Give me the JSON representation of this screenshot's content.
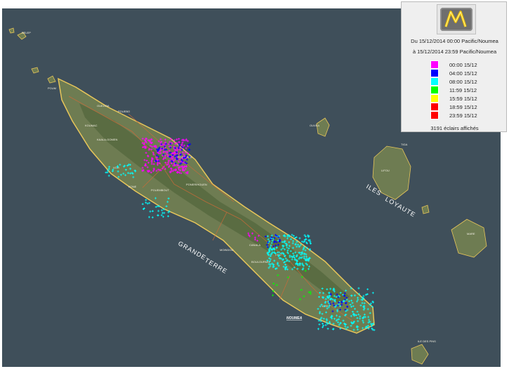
{
  "map": {
    "region_labels": {
      "grande": "GRANDE",
      "terre": "TERRE",
      "iles": "ILES",
      "loyaute": "LOYAUTE"
    },
    "capital": "NOUMEA",
    "places": {
      "belep": "BELEP",
      "poum": "POUM",
      "ouegoa": "OUEGOA",
      "pouebo": "POUEBO",
      "koumac": "KOUMAC",
      "kaala_gomen": "KAALA-GOMEN",
      "voh": "VOH",
      "kone": "KONE",
      "pouembout": "POUEMBOUT",
      "poindimie": "POINDIMIE",
      "ponerihouen": "PONERIHOUEN",
      "canala": "CANALA",
      "moindou": "MOINDOU",
      "bouloupari": "BOULOUPARI",
      "thio": "THIO",
      "yate": "YATE",
      "ouvea": "OUVEA",
      "lifou": "LIFOU",
      "mare": "MARE",
      "tiga": "TIGA",
      "ile_des_pins": "ILE DES PINS"
    },
    "colors": {
      "sea": "#3f4f5a",
      "land": "#6e7c52",
      "coast": "#e8c65a",
      "road": "#c96a3a"
    }
  },
  "legend": {
    "logo_icon": "meteo-france-logo-icon",
    "period_from": "Du 15/12/2014 00:00 Pacific/Noumea",
    "period_to": "à 15/12/2014 23:59 Pacific/Noumea",
    "items": [
      {
        "label": "00:00  15/12",
        "color": "#ff00ff"
      },
      {
        "label": "04:00  15/12",
        "color": "#0000ff"
      },
      {
        "label": "08:00  15/12",
        "color": "#00ffff"
      },
      {
        "label": "11:59  15/12",
        "color": "#00ff00"
      },
      {
        "label": "15:59  15/12",
        "color": "#ffff00"
      },
      {
        "label": "18:59  15/12",
        "color": "#ff0000"
      },
      {
        "label": "23:59  15/12",
        "color": "#ff0000"
      }
    ],
    "count_label": "3191 éclairs affichés"
  },
  "lightning_clusters": [
    {
      "name": "north-magenta",
      "color": "#ff00ff",
      "count": 260
    },
    {
      "name": "north-blue",
      "color": "#0000ff",
      "count": 60
    },
    {
      "name": "west-cyan",
      "color": "#00ffff",
      "count": 30
    },
    {
      "name": "kone-cyan",
      "color": "#00ffff",
      "count": 30
    },
    {
      "name": "central-cyan",
      "color": "#00ffff",
      "count": 230
    },
    {
      "name": "central-blue",
      "color": "#0000ff",
      "count": 20
    },
    {
      "name": "south-cyan",
      "color": "#00ffff",
      "count": 200
    },
    {
      "name": "south-blue",
      "color": "#0000ff",
      "count": 25
    },
    {
      "name": "south-green",
      "color": "#00ff00",
      "count": 14
    },
    {
      "name": "center-magenta",
      "color": "#ff00ff",
      "count": 8
    }
  ]
}
